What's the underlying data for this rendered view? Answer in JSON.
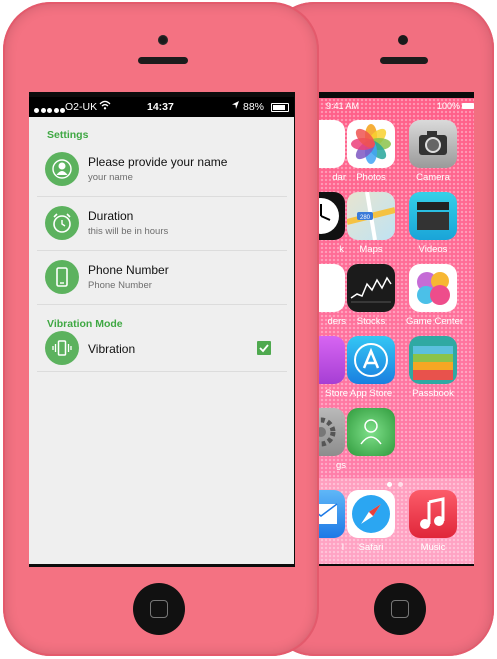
{
  "back_phone": {
    "status": {
      "time": "9:41 AM",
      "battery": "100%"
    },
    "apps": [
      {
        "label": "dar",
        "icon": "calendar-icon"
      },
      {
        "label": "Photos",
        "icon": "photos-icon"
      },
      {
        "label": "Camera",
        "icon": "camera-icon"
      },
      {
        "label": "k",
        "icon": "clock-icon"
      },
      {
        "label": "Maps",
        "icon": "maps-icon"
      },
      {
        "label": "Videos",
        "icon": "videos-icon"
      },
      {
        "label": "ders",
        "icon": "reminders-icon"
      },
      {
        "label": "Stocks",
        "icon": "stocks-icon"
      },
      {
        "label": "Game Center",
        "icon": "game-center-icon"
      },
      {
        "label": "Store",
        "icon": "itunes-store-icon"
      },
      {
        "label": "App Store",
        "icon": "app-store-icon"
      },
      {
        "label": "Passbook",
        "icon": "passbook-icon"
      },
      {
        "label": "gs",
        "icon": "settings-icon"
      },
      {
        "label": "",
        "icon": "custom-app-icon"
      }
    ],
    "dock": [
      {
        "label": "l",
        "icon": "mail-icon"
      },
      {
        "label": "Safari",
        "icon": "safari-icon"
      },
      {
        "label": "Music",
        "icon": "music-icon"
      }
    ]
  },
  "front_phone": {
    "status": {
      "carrier": "O2-UK",
      "time": "14:37",
      "battery": "88%"
    },
    "settings_header": "Settings",
    "rows": [
      {
        "title": "Please provide your name",
        "subtitle": "your name",
        "icon": "person-icon"
      },
      {
        "title": "Duration",
        "subtitle": "this will be in hours",
        "icon": "alarm-clock-icon"
      },
      {
        "title": "Phone Number",
        "subtitle": "Phone Number",
        "icon": "phone-icon"
      }
    ],
    "vibration_header": "Vibration Mode",
    "vibration": {
      "title": "Vibration",
      "checked": true,
      "icon": "vibration-icon"
    }
  },
  "colors": {
    "accent_green": "#5cb25e",
    "header_green": "#3fa843",
    "phone_body": "#f47282"
  }
}
